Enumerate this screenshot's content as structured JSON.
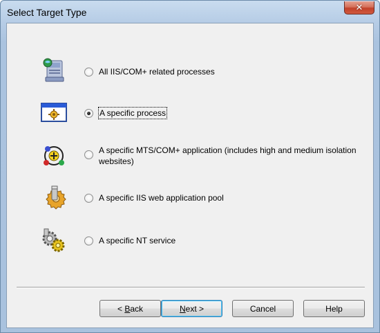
{
  "window": {
    "title": "Select Target Type",
    "close_glyph": "✕"
  },
  "options": [
    {
      "label": "All IIS/COM+ related processes",
      "checked": false,
      "icon": "computer-icon"
    },
    {
      "label": "A specific process",
      "checked": true,
      "icon": "process-window-icon"
    },
    {
      "label": "A specific MTS/COM+ application (includes high and medium isolation websites)",
      "checked": false,
      "icon": "com-application-icon"
    },
    {
      "label": "A specific IIS web application pool",
      "checked": false,
      "icon": "app-pool-gear-icon"
    },
    {
      "label": "A specific NT service",
      "checked": false,
      "icon": "nt-service-gears-icon"
    }
  ],
  "buttons": {
    "back": {
      "prefix": "< ",
      "mnemonic": "B",
      "rest": "ack"
    },
    "next": {
      "mnemonic": "N",
      "rest": "ext >"
    },
    "cancel": "Cancel",
    "help": "Help"
  }
}
